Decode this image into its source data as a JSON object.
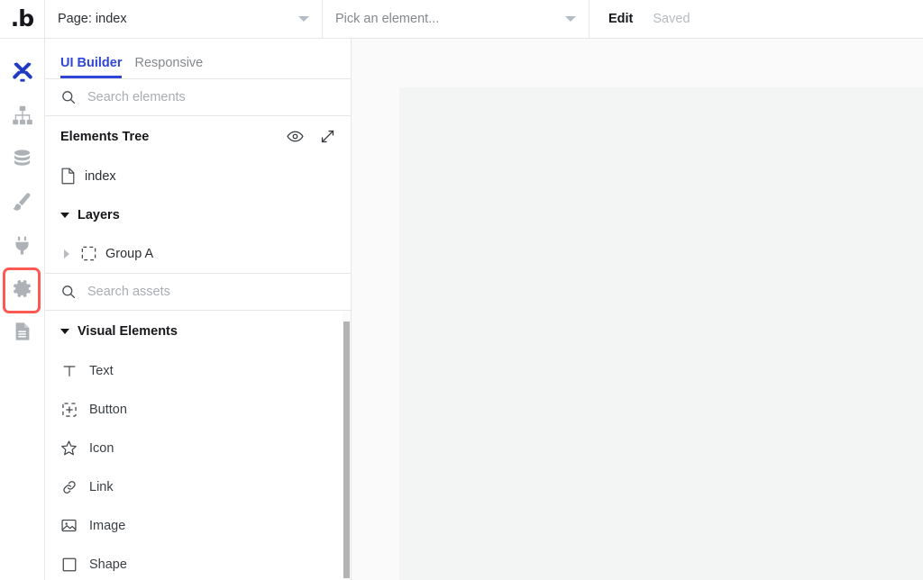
{
  "app": {
    "logo": ".b",
    "logo_icon": "bubble-logo"
  },
  "topbar": {
    "page_selector": {
      "label": "Page: index",
      "caret_icon": "chevron-down-icon"
    },
    "element_selector": {
      "label": "Pick an element...",
      "caret_icon": "chevron-down-icon"
    },
    "edit_label": "Edit",
    "saved_label": "Saved"
  },
  "rail": {
    "items": [
      {
        "name": "design",
        "icon": "design-tools-icon",
        "active": true,
        "highlighted": false
      },
      {
        "name": "workflow",
        "icon": "sitemap-icon",
        "active": false,
        "highlighted": false
      },
      {
        "name": "data",
        "icon": "database-icon",
        "active": false,
        "highlighted": false
      },
      {
        "name": "styles",
        "icon": "paintbrush-icon",
        "active": false,
        "highlighted": false
      },
      {
        "name": "plugins",
        "icon": "plug-icon",
        "active": false,
        "highlighted": false
      },
      {
        "name": "settings",
        "icon": "gear-icon",
        "active": false,
        "highlighted": true
      },
      {
        "name": "logs",
        "icon": "document-icon",
        "active": false,
        "highlighted": false
      }
    ],
    "highlight_color": "#fa5a52",
    "active_color": "#1f3bc4",
    "inactive_color": "#aeb2b6"
  },
  "panel": {
    "tabs": [
      {
        "label": "UI Builder",
        "active": true
      },
      {
        "label": "Responsive",
        "active": false
      }
    ],
    "accent_color": "#2f46d8",
    "search_elements": {
      "placeholder": "Search elements",
      "value": "",
      "icon": "search-icon"
    },
    "elements_tree": {
      "title": "Elements Tree",
      "eye_icon": "eye-icon",
      "expand_icon": "expand-arrows-icon",
      "rows": [
        {
          "label": "index",
          "icon": "page-file-icon",
          "depth": 0,
          "disclosure": "none",
          "bold": false
        },
        {
          "label": "Layers",
          "icon": "none",
          "depth": 0,
          "disclosure": "down",
          "bold": true
        },
        {
          "label": "Group A",
          "icon": "group-dashed-icon",
          "depth": 1,
          "disclosure": "right",
          "bold": false
        }
      ]
    },
    "search_assets": {
      "placeholder": "Search assets",
      "value": "",
      "icon": "search-icon"
    },
    "assets": {
      "group_label": "Visual Elements",
      "group_disclosure": "down",
      "items": [
        {
          "label": "Text",
          "icon": "text-icon"
        },
        {
          "label": "Button",
          "icon": "button-icon"
        },
        {
          "label": "Icon",
          "icon": "star-icon"
        },
        {
          "label": "Link",
          "icon": "link-icon"
        },
        {
          "label": "Image",
          "icon": "image-icon"
        },
        {
          "label": "Shape",
          "icon": "shape-square-icon"
        }
      ]
    }
  },
  "canvas": {
    "background": "#fafafa",
    "page_background": "#f3f4f4"
  }
}
